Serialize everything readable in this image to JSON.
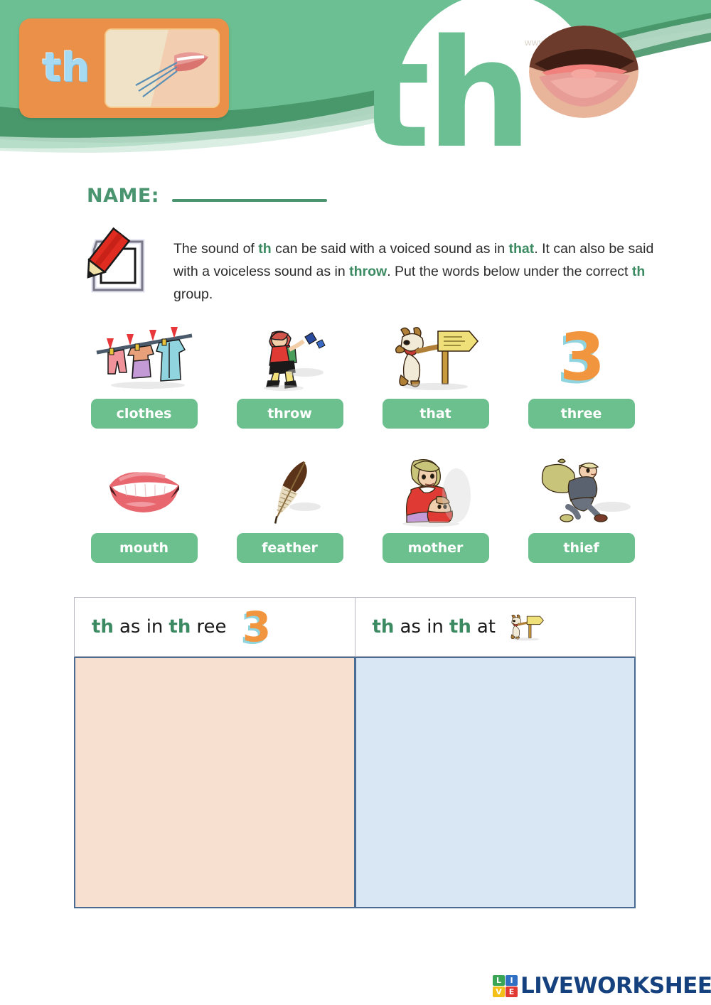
{
  "header": {
    "card_letters": "th",
    "card_icon": "mouth-blowing-air-photo",
    "big_letters": "th",
    "lips_icon": "open-lips-photo",
    "watermark": "www.k"
  },
  "name_field": {
    "label": "NAME:",
    "value": ""
  },
  "instruction": {
    "icon": "pencil-writing-icon",
    "segments": [
      {
        "text": "The sound of ",
        "bold": false
      },
      {
        "text": "th",
        "bold": true
      },
      {
        "text": " can be said with a voiced sound as in ",
        "bold": false
      },
      {
        "text": "that",
        "bold": true
      },
      {
        "text": ". It can also be said with a voiceless sound as in ",
        "bold": false
      },
      {
        "text": "throw",
        "bold": true
      },
      {
        "text": ". Put the words below under the correct ",
        "bold": false
      },
      {
        "text": "th",
        "bold": true
      },
      {
        "text": " group.",
        "bold": false
      }
    ],
    "full_text": "The sound of th can be said with a voiced sound as in that. It can also be said with a voiceless sound as in throw. Put the words below under the correct th group."
  },
  "word_bank": {
    "rows": [
      [
        {
          "word": "clothes",
          "picture": "clothesline-with-clothes-image"
        },
        {
          "word": "throw",
          "picture": "girl-throwing-image"
        },
        {
          "word": "that",
          "picture": "dog-pointing-at-signpost-image"
        },
        {
          "word": "three",
          "picture": "orange-numeral-three-image"
        }
      ],
      [
        {
          "word": "mouth",
          "picture": "pink-smiling-mouth-image"
        },
        {
          "word": "feather",
          "picture": "brown-feather-quill-image"
        },
        {
          "word": "mother",
          "picture": "mother-holding-baby-image"
        },
        {
          "word": "thief",
          "picture": "thief-carrying-sack-image"
        }
      ]
    ]
  },
  "sort_table": {
    "columns": [
      {
        "prefix": "th",
        "middle": " as in ",
        "word_bold": "th",
        "word_rest": "ree",
        "full_heading": "th as in three",
        "picture": "orange-numeral-three-image",
        "zone_color": "#f8e0d1"
      },
      {
        "prefix": "th",
        "middle": " as in ",
        "word_bold": "th",
        "word_rest": "at",
        "full_heading": "th as in that",
        "picture": "dog-pointing-at-signpost-image",
        "zone_color": "#d9e6f4"
      }
    ]
  },
  "footer": {
    "logo_tiles": [
      {
        "letter": "L",
        "color": "#3aa655"
      },
      {
        "letter": "I",
        "color": "#2f6fc4"
      },
      {
        "letter": "V",
        "color": "#f2c018"
      },
      {
        "letter": "E",
        "color": "#e03a32"
      }
    ],
    "brand": "LIVEWORKSHEETS"
  },
  "colors": {
    "banner_green": "#6cbf92",
    "banner_green_dark": "#469468",
    "accent_green": "#3b8a62",
    "chip_green": "#6cc08d",
    "card_orange": "#eb9049",
    "brand_blue": "#15417e"
  }
}
